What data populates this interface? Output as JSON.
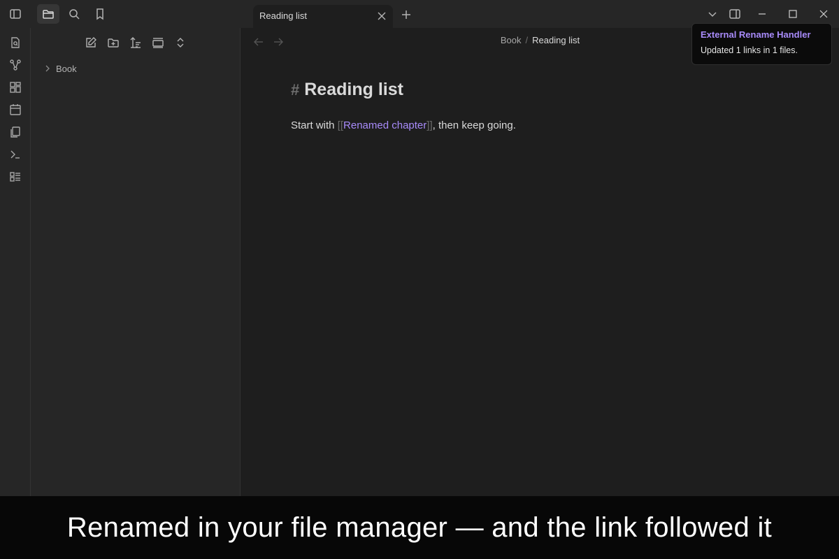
{
  "tab": {
    "title": "Reading list"
  },
  "breadcrumb": {
    "parent": "Book",
    "separator": "/",
    "current": "Reading list"
  },
  "tree": {
    "items": [
      {
        "label": "Book"
      }
    ]
  },
  "note": {
    "heading_mark": "#",
    "heading": "Reading list",
    "text_before": "Start with ",
    "link_open": "[[",
    "link_text": "Renamed chapter",
    "link_close": "]]",
    "text_after": ", then keep going."
  },
  "notice": {
    "title": "External Rename Handler",
    "body": "Updated 1 links in 1 files."
  },
  "caption": "Renamed in your file manager — and the link followed it",
  "colors": {
    "accent": "#a88bfa",
    "background": "#1e1e1e",
    "panel": "#262626"
  },
  "icons": {
    "titlebar": [
      "sidebar-toggle-icon",
      "folder-icon",
      "search-icon",
      "bookmark-icon"
    ],
    "ribbon": [
      "open-quick-switcher-icon",
      "graph-view-icon",
      "canvas-icon",
      "daily-note-icon",
      "templates-icon",
      "command-palette-icon",
      "bases-icon"
    ],
    "explorer_toolbar": [
      "new-note-icon",
      "new-folder-icon",
      "sort-icon",
      "auto-reveal-icon",
      "collapse-all-icon"
    ]
  }
}
